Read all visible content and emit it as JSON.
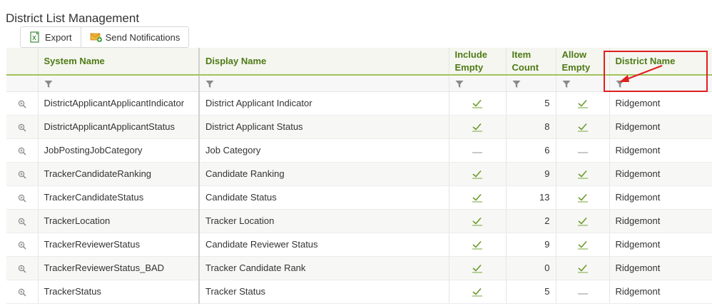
{
  "page": {
    "title": "District List Management"
  },
  "toolbar": {
    "export_label": "Export",
    "send_notifications_label": "Send Notifications"
  },
  "columns": {
    "system_name": "System Name",
    "display_name": "Display Name",
    "include_empty_1": "Include",
    "include_empty_2": "Empty",
    "item_count_1": "Item",
    "item_count_2": "Count",
    "allow_empty_1": "Allow",
    "allow_empty_2": "Empty",
    "district_name": "District Name"
  },
  "rows": [
    {
      "system_name": "DistrictApplicantApplicantIndicator",
      "display_name": "District Applicant Indicator",
      "include_empty": true,
      "item_count": "5",
      "allow_empty": true,
      "district_name": "Ridgemont"
    },
    {
      "system_name": "DistrictApplicantApplicantStatus",
      "display_name": "District Applicant Status",
      "include_empty": true,
      "item_count": "8",
      "allow_empty": true,
      "district_name": "Ridgemont"
    },
    {
      "system_name": "JobPostingJobCategory",
      "display_name": "Job Category",
      "include_empty": false,
      "item_count": "6",
      "allow_empty": false,
      "district_name": "Ridgemont"
    },
    {
      "system_name": "TrackerCandidateRanking",
      "display_name": "Candidate Ranking",
      "include_empty": true,
      "item_count": "9",
      "allow_empty": true,
      "district_name": "Ridgemont"
    },
    {
      "system_name": "TrackerCandidateStatus",
      "display_name": "Candidate Status",
      "include_empty": true,
      "item_count": "13",
      "allow_empty": true,
      "district_name": "Ridgemont"
    },
    {
      "system_name": "TrackerLocation",
      "display_name": "Tracker Location",
      "include_empty": true,
      "item_count": "2",
      "allow_empty": true,
      "district_name": "Ridgemont"
    },
    {
      "system_name": "TrackerReviewerStatus",
      "display_name": "Candidate Reviewer Status",
      "include_empty": true,
      "item_count": "9",
      "allow_empty": true,
      "district_name": "Ridgemont"
    },
    {
      "system_name": "TrackerReviewerStatus_BAD",
      "display_name": "Tracker Candidate Rank",
      "include_empty": true,
      "item_count": "0",
      "allow_empty": true,
      "district_name": "Ridgemont"
    },
    {
      "system_name": "TrackerStatus",
      "display_name": "Tracker Status",
      "include_empty": true,
      "item_count": "5",
      "allow_empty": false,
      "district_name": "Ridgemont"
    }
  ],
  "icons": {
    "export": "excel-icon",
    "send_notifications": "envelope-plus-icon",
    "filter": "funnel-icon",
    "row_detail": "magnifier-icon",
    "true_value": "check-icon",
    "false_value": "dash-icon"
  },
  "colors": {
    "header_text": "#4f7a17",
    "header_underline": "#a3c25a",
    "check": "#6a9a2a",
    "annotation": "#e02020"
  }
}
